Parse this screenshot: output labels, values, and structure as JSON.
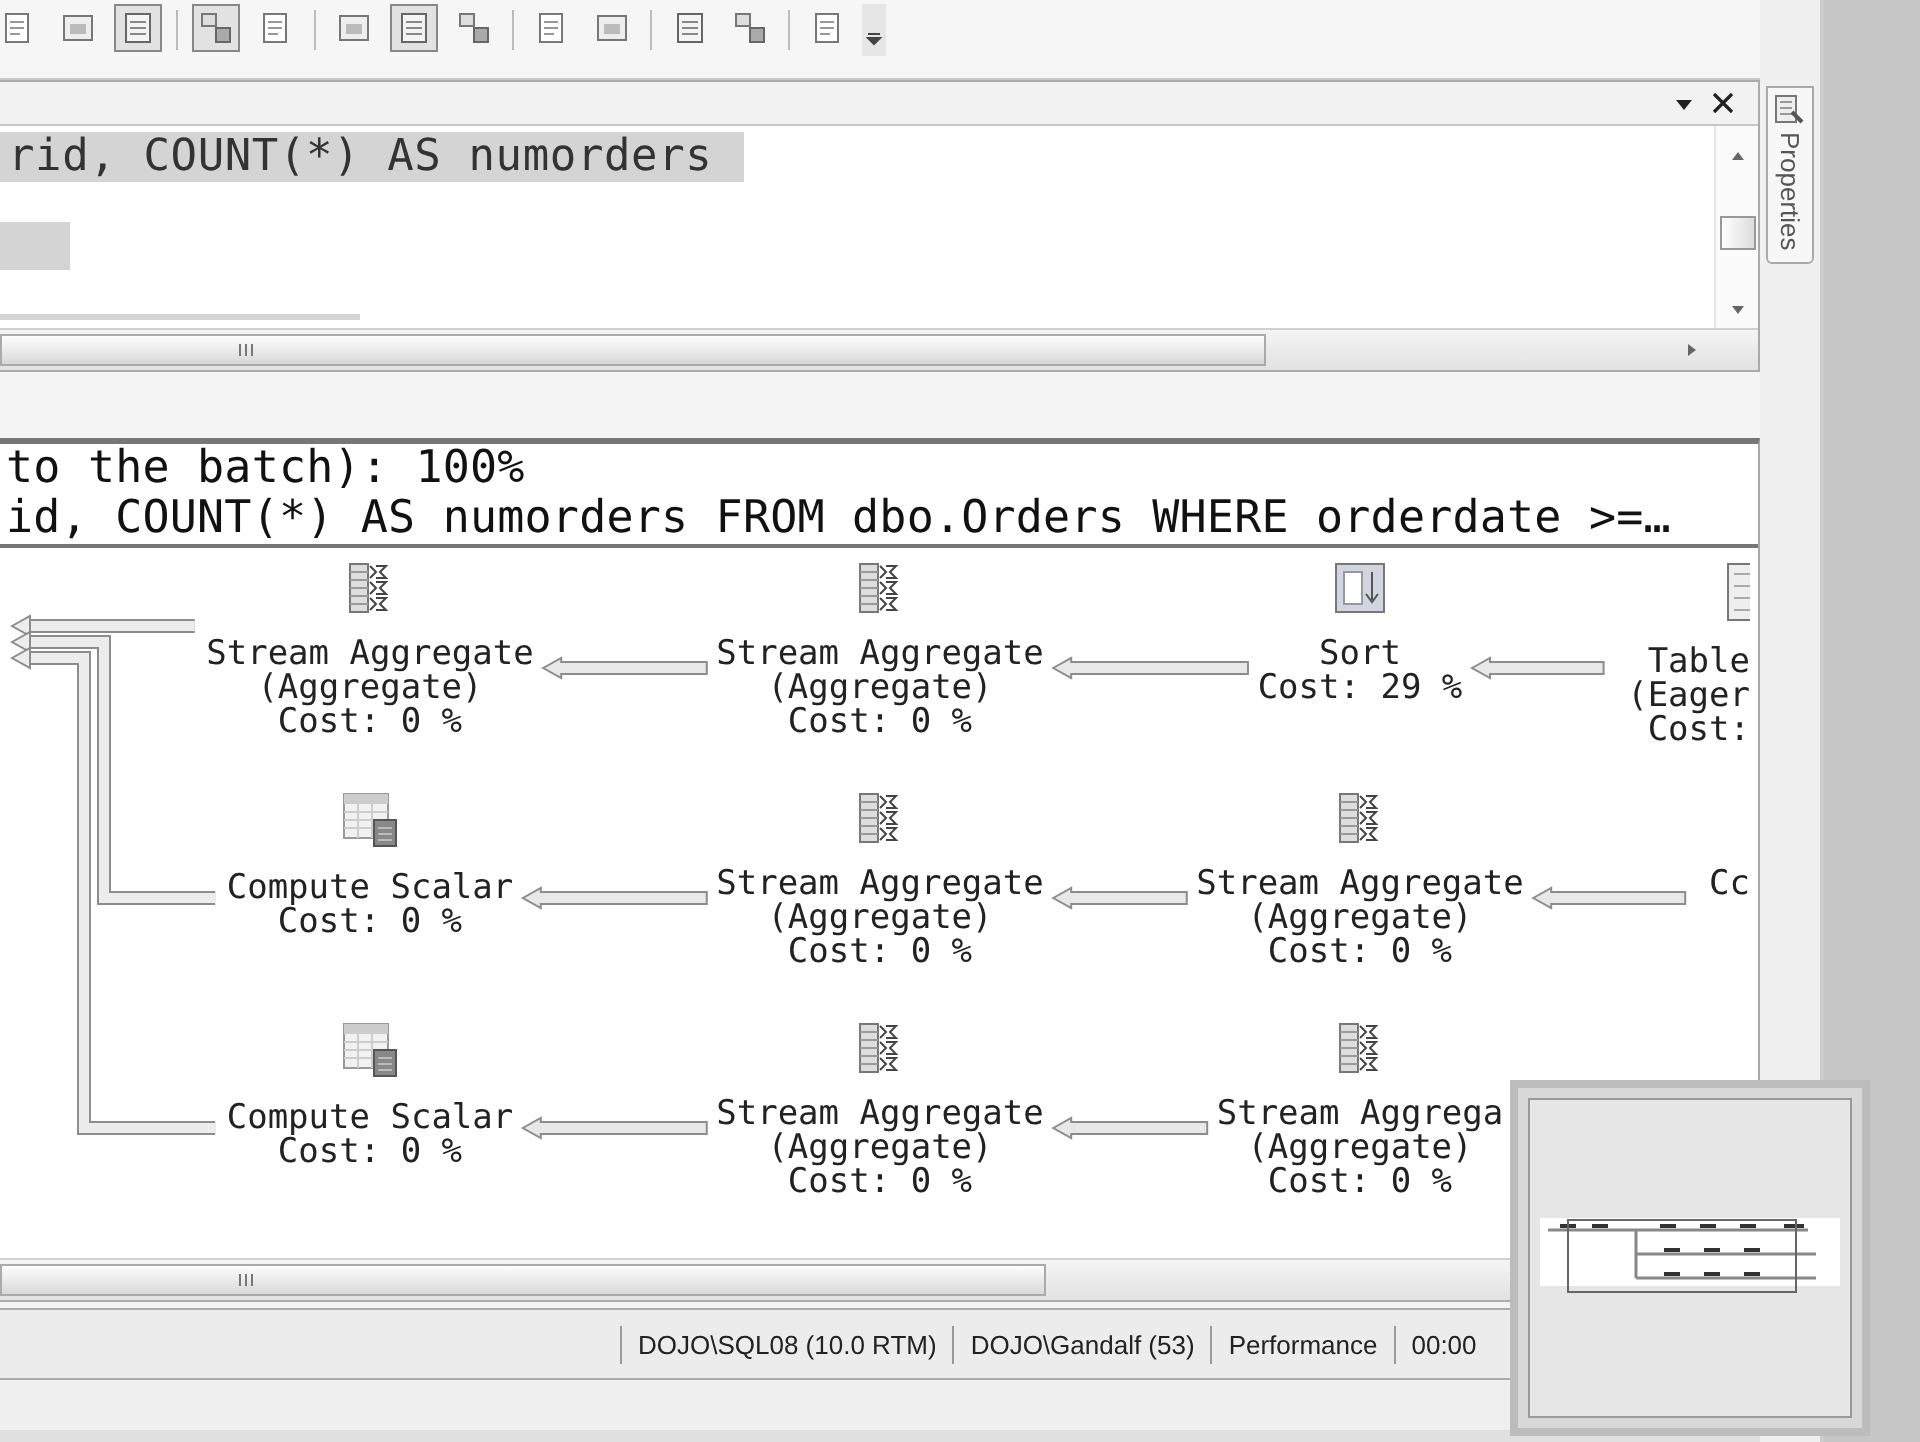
{
  "toolbar": {
    "groups": [
      [
        {
          "pressed": false
        },
        {
          "pressed": false
        },
        {
          "pressed": true
        }
      ],
      [
        {
          "pressed": true
        },
        {
          "pressed": false
        }
      ],
      [
        {
          "pressed": false
        },
        {
          "pressed": true
        },
        {
          "pressed": false
        }
      ],
      [
        {
          "pressed": false
        },
        {
          "pressed": false
        }
      ],
      [
        {
          "pressed": false
        },
        {
          "pressed": false
        }
      ],
      [
        {
          "pressed": false
        }
      ]
    ]
  },
  "editor": {
    "lines": [
      {
        "text": "rid, COUNT(*) AS numorders",
        "selected": true
      }
    ]
  },
  "side_tabs": [
    {
      "label": "Properties"
    }
  ],
  "plan": {
    "header_lines": [
      "to the batch): 100%",
      "id, COUNT(*) AS numorders FROM dbo.Orders WHERE orderdate >=…"
    ],
    "rows": [
      {
        "nodes": [
          {
            "kind": "stream-aggregate",
            "lines": [
              "Stream Aggregate",
              "(Aggregate)",
              "Cost: 0 %"
            ]
          },
          {
            "kind": "stream-aggregate",
            "lines": [
              "Stream Aggregate",
              "(Aggregate)",
              "Cost: 0 %"
            ]
          },
          {
            "kind": "sort",
            "lines": [
              "Sort",
              "Cost: 29 %"
            ]
          },
          {
            "kind": "cut-table",
            "lines": [
              "Table",
              "(Eager",
              "Cost:"
            ]
          }
        ]
      },
      {
        "nodes": [
          {
            "kind": "compute-scalar",
            "lines": [
              "Compute Scalar",
              "Cost: 0 %"
            ]
          },
          {
            "kind": "stream-aggregate",
            "lines": [
              "Stream Aggregate",
              "(Aggregate)",
              "Cost: 0 %"
            ]
          },
          {
            "kind": "stream-aggregate",
            "lines": [
              "Stream Aggregate",
              "(Aggregate)",
              "Cost: 0 %"
            ]
          },
          {
            "kind": "cut-plain",
            "lines": [
              "Cc"
            ]
          }
        ]
      },
      {
        "nodes": [
          {
            "kind": "compute-scalar",
            "lines": [
              "Compute Scalar",
              "Cost: 0 %"
            ]
          },
          {
            "kind": "stream-aggregate",
            "lines": [
              "Stream Aggregate",
              "(Aggregate)",
              "Cost: 0 %"
            ]
          },
          {
            "kind": "stream-aggregate",
            "lines": [
              "Stream Aggrega",
              "(Aggregate)",
              "Cost: 0 %"
            ]
          }
        ]
      }
    ]
  },
  "status_bar": {
    "items": [
      "DOJO\\SQL08 (10.0 RTM)",
      "DOJO\\Gandalf (53)",
      "Performance",
      "00:00"
    ]
  }
}
